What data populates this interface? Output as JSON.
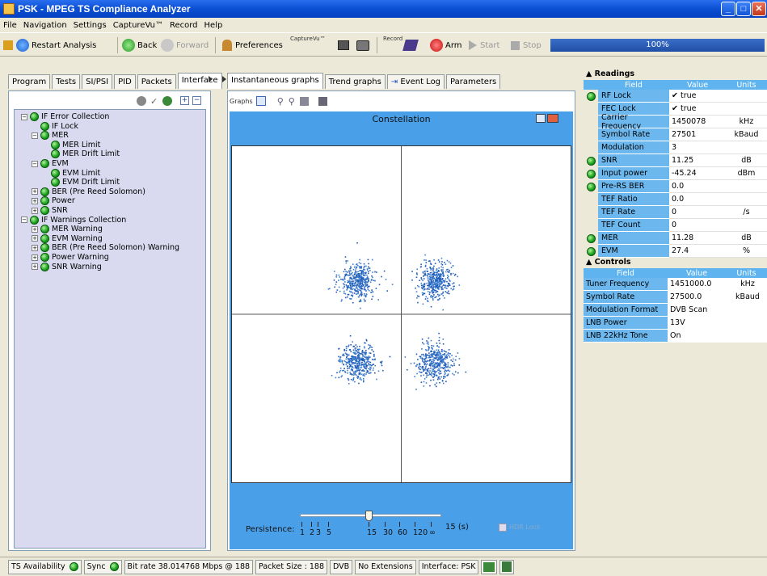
{
  "window": {
    "title": "PSK - MPEG TS Compliance Analyzer"
  },
  "menu": [
    "File",
    "Navigation",
    "Settings",
    "CaptureVu™",
    "Record",
    "Help"
  ],
  "toolbar": {
    "restart": "Restart Analysis",
    "back": "Back",
    "forward": "Forward",
    "preferences": "Preferences",
    "capture_label": "CaptureVu™",
    "record_label": "Record",
    "arm": "Arm",
    "start": "Start",
    "stop": "Stop",
    "progress": "100%"
  },
  "left_tabs": [
    "Program",
    "Tests",
    "SI/PSI",
    "PID",
    "Packets",
    "Interface"
  ],
  "left_active_tab": "Interface",
  "tree": [
    {
      "label": "IF Error Collection",
      "level": 0,
      "expander": "−"
    },
    {
      "label": "IF Lock",
      "level": 1,
      "expander": ""
    },
    {
      "label": "MER",
      "level": 1,
      "expander": "−"
    },
    {
      "label": "MER Limit",
      "level": 2,
      "expander": ""
    },
    {
      "label": "MER Drift Limit",
      "level": 2,
      "expander": ""
    },
    {
      "label": "EVM",
      "level": 1,
      "expander": "−"
    },
    {
      "label": "EVM Limit",
      "level": 2,
      "expander": ""
    },
    {
      "label": "EVM Drift Limit",
      "level": 2,
      "expander": ""
    },
    {
      "label": "BER (Pre Reed Solomon)",
      "level": 1,
      "expander": "+"
    },
    {
      "label": "Power",
      "level": 1,
      "expander": "+"
    },
    {
      "label": "SNR",
      "level": 1,
      "expander": "+"
    },
    {
      "label": "IF Warnings Collection",
      "level": 0,
      "expander": "−"
    },
    {
      "label": "MER Warning",
      "level": 1,
      "expander": "+"
    },
    {
      "label": "EVM Warning",
      "level": 1,
      "expander": "+"
    },
    {
      "label": "BER (Pre Reed Solomon) Warning",
      "level": 1,
      "expander": "+"
    },
    {
      "label": "Power Warning",
      "level": 1,
      "expander": "+"
    },
    {
      "label": "SNR Warning",
      "level": 1,
      "expander": "+"
    }
  ],
  "center_tabs": [
    "Instantaneous graphs",
    "Trend graphs",
    "Event Log",
    "Parameters"
  ],
  "center_active_tab": "Instantaneous graphs",
  "graphs_label": "Graphs",
  "constellation": {
    "title": "Constellation",
    "persistence_label": "Persistence:",
    "persistence_value": "15 (s)",
    "persistence_ticks": [
      "1",
      "2",
      "3",
      "5",
      "15",
      "30",
      "60",
      "120",
      "∞"
    ],
    "slider_position_index": 4,
    "checkbox_label": "HDR Lock"
  },
  "readings": {
    "title": "Readings",
    "headers": [
      "Field",
      "Value",
      "Units"
    ],
    "rows": [
      {
        "led": true,
        "field": "RF Lock",
        "value": "✔ true",
        "units": ""
      },
      {
        "led": false,
        "field": "FEC Lock",
        "value": "✔ true",
        "units": ""
      },
      {
        "led": false,
        "field": "Carrier Frequency",
        "value": "1450078",
        "units": "kHz"
      },
      {
        "led": false,
        "field": "Symbol Rate",
        "value": "27501",
        "units": "kBaud"
      },
      {
        "led": false,
        "field": "Modulation",
        "value": "3",
        "units": ""
      },
      {
        "led": true,
        "field": "SNR",
        "value": "11.25",
        "units": "dB"
      },
      {
        "led": true,
        "field": "Input power",
        "value": "-45.24",
        "units": "dBm"
      },
      {
        "led": true,
        "field": "Pre-RS BER",
        "value": "0.0",
        "units": ""
      },
      {
        "led": false,
        "field": "TEF Ratio",
        "value": "0.0",
        "units": ""
      },
      {
        "led": false,
        "field": "TEF Rate",
        "value": "0",
        "units": "/s"
      },
      {
        "led": false,
        "field": "TEF Count",
        "value": "0",
        "units": ""
      },
      {
        "led": true,
        "field": "MER",
        "value": "11.28",
        "units": "dB"
      },
      {
        "led": true,
        "field": "EVM",
        "value": "27.4",
        "units": "%"
      }
    ]
  },
  "controls": {
    "title": "Controls",
    "headers": [
      "Field",
      "Value",
      "Units"
    ],
    "rows": [
      {
        "field": "Tuner Frequency",
        "value": "1451000.0",
        "units": "kHz"
      },
      {
        "field": "Symbol Rate",
        "value": "27500.0",
        "units": "kBaud"
      },
      {
        "field": "Modulation Format",
        "value": "DVB Scan",
        "units": ""
      },
      {
        "field": "LNB Power",
        "value": "13V",
        "units": ""
      },
      {
        "field": "LNB 22kHz Tone",
        "value": "On",
        "units": ""
      }
    ]
  },
  "status": {
    "ts_availability": "TS Availability",
    "sync": "Sync",
    "bitrate": "Bit rate  38.014768 Mbps @ 188",
    "packet_size": "Packet Size : 188",
    "dvb": "DVB",
    "extensions": "No Extensions",
    "interface": "Interface: PSK"
  },
  "colors": {
    "accent": "#0a4fd2",
    "plot_bg": "#4aa0e8",
    "table_field": "#6cb7ee",
    "led_green": "#18a01c",
    "scatter": "#1f5ab4"
  }
}
